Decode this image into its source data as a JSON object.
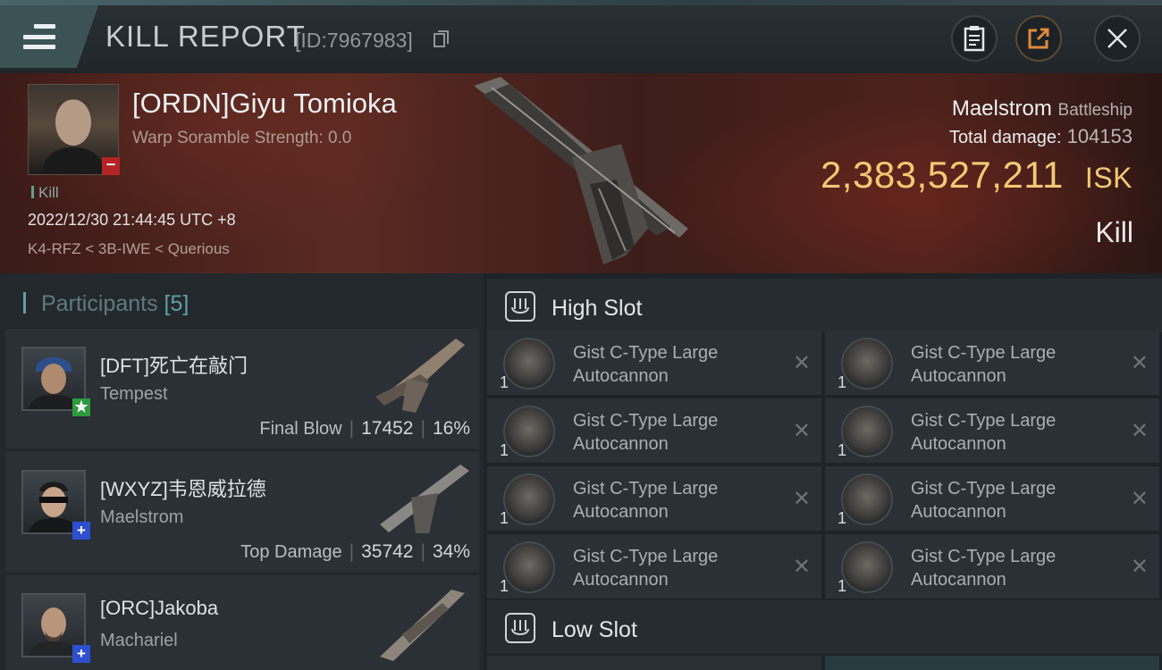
{
  "header": {
    "title": "KILL REPORT",
    "report_id": "[ID:7967983]"
  },
  "victim": {
    "name": "[ORDN]Giyu Tomioka",
    "warp_scramble": "Warp Soramble Strength: 0.0",
    "tag": "Kill",
    "datetime": "2022/12/30 21:44:45 UTC +8",
    "location": "K4-RFZ < 3B-IWE < Querious",
    "ship_name": "Maelstrom",
    "ship_class": "Battleship",
    "total_damage_label": "Total damage:",
    "total_damage": "104153",
    "isk_value": "2,383,527,211",
    "isk_unit": "ISK",
    "result": "Kill"
  },
  "participants": {
    "label": "Participants",
    "count": "[5]",
    "rows": [
      {
        "name": "[DFT]死亡在敲门",
        "ship": "Tempest",
        "stat_label": "Final Blow",
        "damage": "17452",
        "percent": "16%",
        "badge": "★"
      },
      {
        "name": "[WXYZ]韦恩威拉德",
        "ship": "Maelstrom",
        "stat_label": "Top Damage",
        "damage": "35742",
        "percent": "34%",
        "badge": "+"
      },
      {
        "name": "[ORC]Jakoba",
        "ship": "Machariel",
        "badge": "+"
      }
    ]
  },
  "fitting": {
    "high_slot_label": "High Slot",
    "low_slot_label": "Low Slot",
    "module_line1": "Gist C-Type Large",
    "module_line2": "Autocannon",
    "qty": "1",
    "remove_glyph": "✕"
  },
  "colors": {
    "isk_gold": "#f3c974",
    "accent_teal": "#5fa0a5",
    "banner_red": "#5a2a22"
  }
}
